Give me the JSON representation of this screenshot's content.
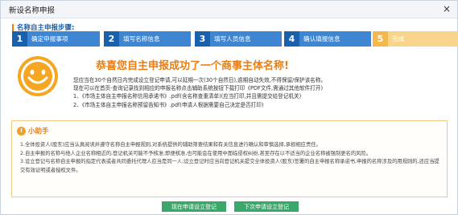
{
  "window": {
    "title": "新设名称申报",
    "close_glyph": "×"
  },
  "steps_label": "名称自主申报步骤:",
  "steps": [
    {
      "num": "1",
      "label": "确定申报事项"
    },
    {
      "num": "2",
      "label": "填写名称信息"
    },
    {
      "num": "3",
      "label": "填写人员信息"
    },
    {
      "num": "4",
      "label": "确认填报信息"
    },
    {
      "num": "5",
      "label": "完成"
    }
  ],
  "result": {
    "headline": "恭喜您自主申报成功了一个商事主体名称!",
    "line1": "您应当在30个自然日内完成设立登记申请,可以延期一次(30个自然日),逾期自动失效,不得保留/保护该名称。",
    "line2": "现在可以在首页-查询记录找到相应的申报名称点击辅助系统按钮下载打印《PDF文件,需通过其他软件打开)",
    "line3": "1、《市场主体自主申报名称信用承诺书》.pdf(含名称查重清单)(应当打印,并且需提交给登记机关)",
    "line4": "2、《市场主体自主申报名称预留告知书》.pdf(申请人根据需要自己决定是否打印)"
  },
  "helper": {
    "icon": "!",
    "title": "小助手",
    "item1": "1.全体投资人(股东)应当认真阅读并遵守名称自主申报规则,对系统提供的辅助筛查结果和有关信息进行确认和审慎选择,承担相应责任。",
    "item2": "2.自主申报的名称与他人企业名称相近的,登记机关可能不予核准;即便核准,也可能会在使用中面临侵权纠纷,甚至存在以不适当的企业名称被强制更名的风险。",
    "item3": "3.设立登记与名称自主申报的指定代表或者共同委托代理人应当是同一人;设立登记时应当向登记机关提交全体投资人(股东)签署的自主申报名称承诺书,申报的名称涉及的用规则的,还应当提交有效证明或者授权文件。"
  },
  "buttons": {
    "now": "现在申请设立登记",
    "later": "下次申请设立登记"
  },
  "colors": {
    "step_active": "#1a61ad",
    "step_active_label": "#3e86d2",
    "step_done": "#f5b84a",
    "accent_orange": "#e87e14",
    "button_green": "#3aa86a"
  }
}
